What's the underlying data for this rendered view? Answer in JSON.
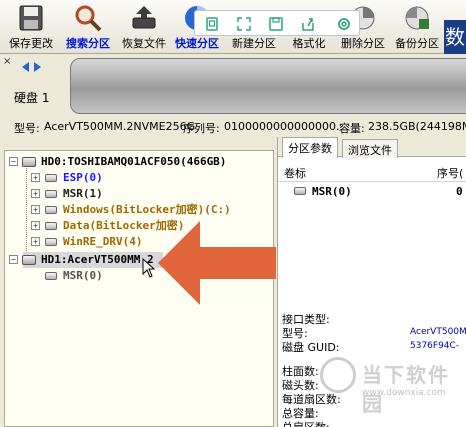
{
  "toolbar": {
    "buttons": [
      {
        "label": "保存更改",
        "icon": "save-disk-icon"
      },
      {
        "label": "搜索分区",
        "icon": "search-magnifier-icon"
      },
      {
        "label": "恢复文件",
        "icon": "restore-file-icon"
      },
      {
        "label": "快速分区",
        "icon": "quick-partition-icon"
      },
      {
        "label": "新建分区",
        "icon": "new-partition-icon"
      },
      {
        "label": "格式化",
        "icon": "format-icon"
      },
      {
        "label": "删除分区",
        "icon": "delete-partition-icon"
      },
      {
        "label": "备份分区",
        "icon": "backup-partition-icon"
      }
    ],
    "brand_char": "数",
    "float_icons": [
      "screen-icon",
      "fullscreen-icon",
      "save-icon",
      "share-icon",
      "settings-icon"
    ]
  },
  "diskstrip": {
    "close": "×",
    "disk_label": "硬盘 1"
  },
  "diskinfo": {
    "model_label": "型号:",
    "model": "AcerVT500MM.2NVME256G",
    "serial_label": "序列号:",
    "serial": "0100000000000000.",
    "capacity_label": "容量:",
    "capacity": "238.5GB(244198MB)"
  },
  "tree": {
    "disk0": "HD0:TOSHIBAMQ01ACF050(466GB)",
    "partitions0": [
      "ESP(0)",
      "MSR(1)",
      "Windows(BitLocker加密)(C:)",
      "Data(BitLocker加密)",
      "WinRE_DRV(4)"
    ],
    "disk1": "HD1:AcerVT500MM.2",
    "partitions1": [
      "MSR(0)"
    ]
  },
  "right": {
    "tabs": [
      "分区参数",
      "浏览文件"
    ],
    "col_volume": "卷标",
    "col_index": "序号(",
    "row_volume": "MSR(0)",
    "row_index": "0",
    "details": {
      "iface_label": "接口类型:",
      "model_label": "型号:",
      "model_value": "AcerVT500M",
      "guid_label": "磁盘 GUID:",
      "guid_value": "5376F94C-",
      "cyl_label": "柱面数:",
      "heads_label": "磁头数:",
      "spt_label": "每道扇区数:",
      "total_label": "总容量:",
      "total_sectors_label": "总扇区数:"
    }
  },
  "watermark": {
    "text": "当下软件园",
    "url": "www.downxia.com"
  },
  "colors": {
    "arrow": "#e0653a",
    "tree_partition": "#9c6a00",
    "esp_blue": "#1a1aff",
    "toolbar_active": "#0018d8"
  }
}
